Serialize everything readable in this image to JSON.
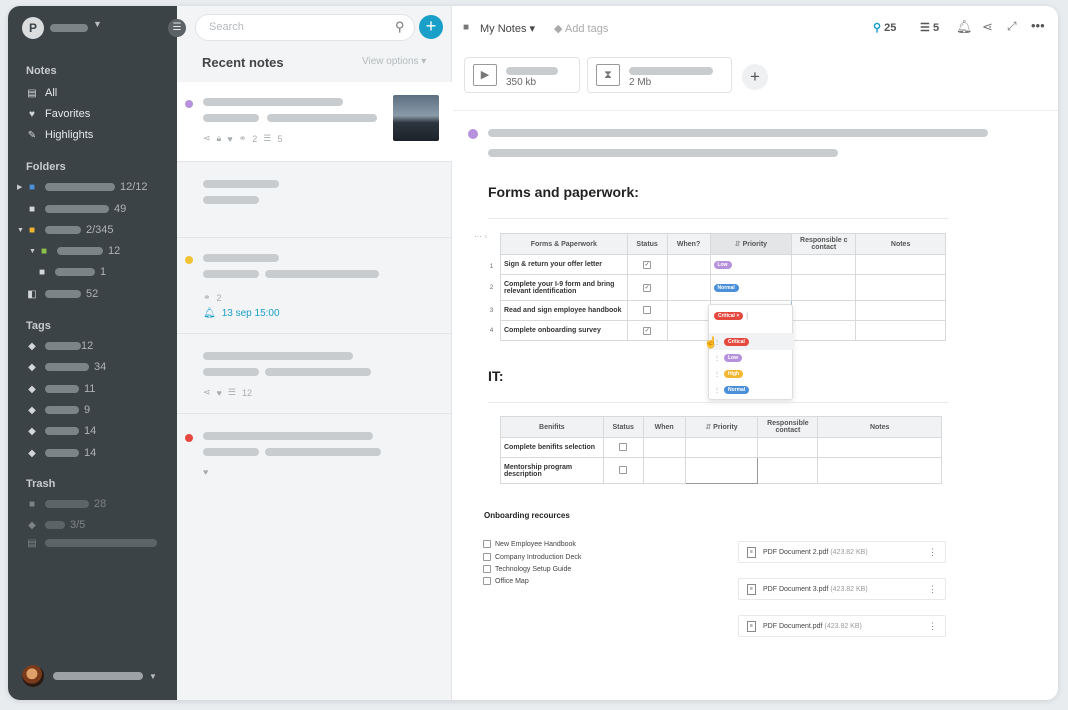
{
  "sidebar": {
    "avatar_letter": "P",
    "notes_section": "Notes",
    "notes_items": [
      {
        "label": "All"
      },
      {
        "label": "Favorites"
      },
      {
        "label": "Highlights"
      }
    ],
    "folders_section": "Folders",
    "folders": [
      {
        "count": "12/12"
      },
      {
        "count": "49"
      },
      {
        "count": "2/345"
      },
      {
        "count": "12"
      },
      {
        "count": "1"
      },
      {
        "count": "52"
      }
    ],
    "tags_section": "Tags",
    "tags": [
      {
        "count": "12"
      },
      {
        "count": "34"
      },
      {
        "count": "11"
      },
      {
        "count": "9"
      },
      {
        "count": "14"
      },
      {
        "count": "14"
      }
    ],
    "trash_section": "Trash",
    "trash": [
      {
        "count": "28"
      },
      {
        "count": "3/5"
      }
    ]
  },
  "list": {
    "search_placeholder": "Search",
    "title": "Recent notes",
    "view_options": "View options",
    "cards": [
      {
        "color": "#b592db",
        "shares": "2",
        "tasks": "5"
      },
      {
        "color": "#ffffff"
      },
      {
        "color": "#f2c235",
        "shares": "2",
        "reminder": "13 sep 15:00"
      },
      {
        "color": "#ffffff",
        "tasks": "12"
      },
      {
        "color": "#e5483f"
      }
    ]
  },
  "toolbar": {
    "folder": "My Notes",
    "add_tags": "Add tags",
    "attachments_count": "25",
    "tasks_count": "5"
  },
  "attachments": [
    {
      "size": "350 kb"
    },
    {
      "size": "2 Mb"
    }
  ],
  "doc": {
    "heading1": "Forms and paperwork:",
    "table1": {
      "headers": [
        "Forms & Paperwork",
        "Status",
        "When?",
        "Priority",
        "Responsible c contact",
        "Notes"
      ],
      "rows": [
        {
          "n": "1",
          "task": "Sign & return your offer letter",
          "priority": "Low"
        },
        {
          "n": "2",
          "task": "Complete your I-9 form and bring relevant identification",
          "priority": "Normal"
        },
        {
          "n": "3",
          "task": "Read and sign employee handbook",
          "priority": "Critical"
        },
        {
          "n": "4",
          "task": "Complete onboarding survey",
          "priority": ""
        }
      ]
    },
    "dropdown_options": [
      "Critical",
      "Low",
      "High",
      "Normal"
    ],
    "heading2": "IT:",
    "table2": {
      "headers": [
        "Benifits",
        "Status",
        "When",
        "Priority",
        "Responsible contact",
        "Notes"
      ],
      "rows": [
        {
          "task": "Complete benifits selection"
        },
        {
          "task": "Mentorship program description"
        }
      ]
    },
    "resources_title": "Onboarding recources",
    "resources": [
      "New Employee Handbook",
      "Company Introduction Deck",
      "Technology Setup Guide",
      "Office Map"
    ],
    "pdfs": [
      {
        "name": "PDF Document 2.pdf",
        "size": "(423.82 KB)"
      },
      {
        "name": "PDF Document 3.pdf",
        "size": "(423.82 KB)"
      },
      {
        "name": "PDF Document.pdf",
        "size": "(423.82 KB)"
      }
    ]
  },
  "colors": {
    "accent": "#1aa0c8",
    "critical": "#e5483f",
    "low": "#b592db",
    "high": "#f2b630",
    "normal": "#4a90d9"
  }
}
